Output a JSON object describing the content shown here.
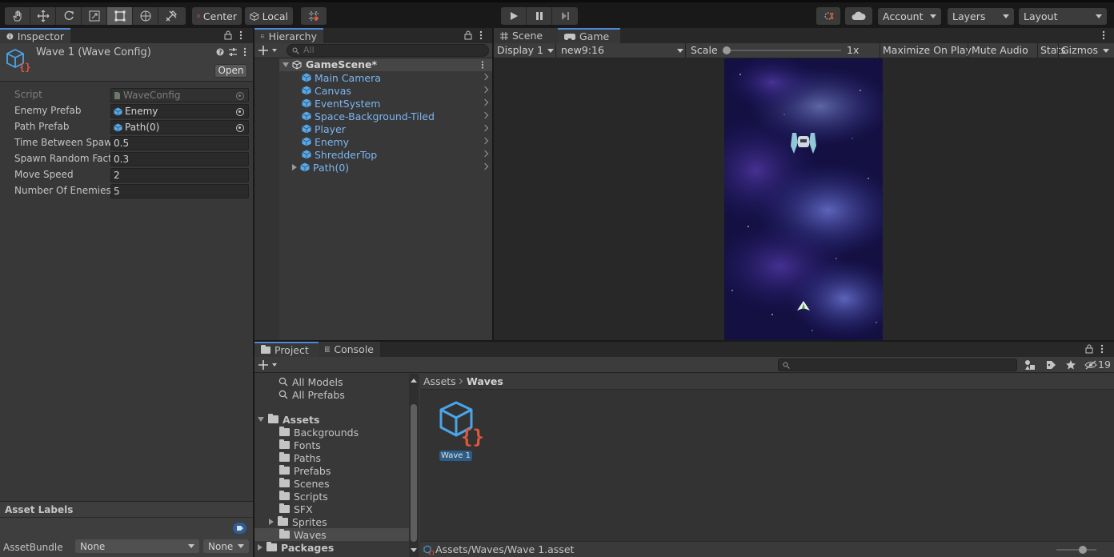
{
  "toolbar": {
    "pivot_label": "Center",
    "space_label": "Local",
    "account_label": "Account",
    "layers_label": "Layers",
    "layout_label": "Layout"
  },
  "inspector": {
    "tab_label": "Inspector",
    "asset_title": "Wave 1 (Wave Config)",
    "open_button": "Open",
    "properties": [
      {
        "label": "Script",
        "value": "WaveConfig"
      },
      {
        "label": "Enemy Prefab",
        "value": "Enemy"
      },
      {
        "label": "Path Prefab",
        "value": "Path(0)"
      },
      {
        "label": "Time Between Spawns",
        "value": "0.5"
      },
      {
        "label": "Spawn Random Factor",
        "value": "0.3"
      },
      {
        "label": "Move Speed",
        "value": "2"
      },
      {
        "label": "Number Of Enemies",
        "value": "5"
      }
    ],
    "asset_labels_title": "Asset Labels",
    "assetbundle_label": "AssetBundle",
    "assetbundle_value": "None",
    "assetbundle_variant": "None"
  },
  "hierarchy": {
    "tab_label": "Hierarchy",
    "search_placeholder": "All",
    "scene_name": "GameScene*",
    "items": [
      "Main Camera",
      "Canvas",
      "EventSystem",
      "Space-Background-Tiled",
      "Player",
      "Enemy",
      "ShredderTop",
      "Path(0)"
    ]
  },
  "game": {
    "scene_tab": "Scene",
    "game_tab": "Game",
    "display_label": "Display 1",
    "aspect_label": "new9:16",
    "scale_label": "Scale",
    "scale_value": "1x",
    "maximize_label": "Maximize On Play",
    "mute_label": "Mute Audio",
    "stats_label": "Stats",
    "gizmos_label": "Gizmos"
  },
  "project": {
    "project_tab": "Project",
    "console_tab": "Console",
    "hidden_count": "19",
    "favorites": [
      "All Models",
      "All Prefabs"
    ],
    "assets_root": "Assets",
    "folders": [
      "Backgrounds",
      "Fonts",
      "Paths",
      "Prefabs",
      "Scenes",
      "Scripts",
      "SFX",
      "Sprites",
      "Waves"
    ],
    "packages_label": "Packages",
    "breadcrumb_root": "Assets",
    "breadcrumb_current": "Waves",
    "asset_name": "Wave 1",
    "footer_path": "Assets/Waves/Wave 1.asset"
  },
  "colors": {
    "accent_blue": "#4d8ad5",
    "hierarchy_text": "#7cb5f2",
    "selection": "#2c5d87"
  }
}
